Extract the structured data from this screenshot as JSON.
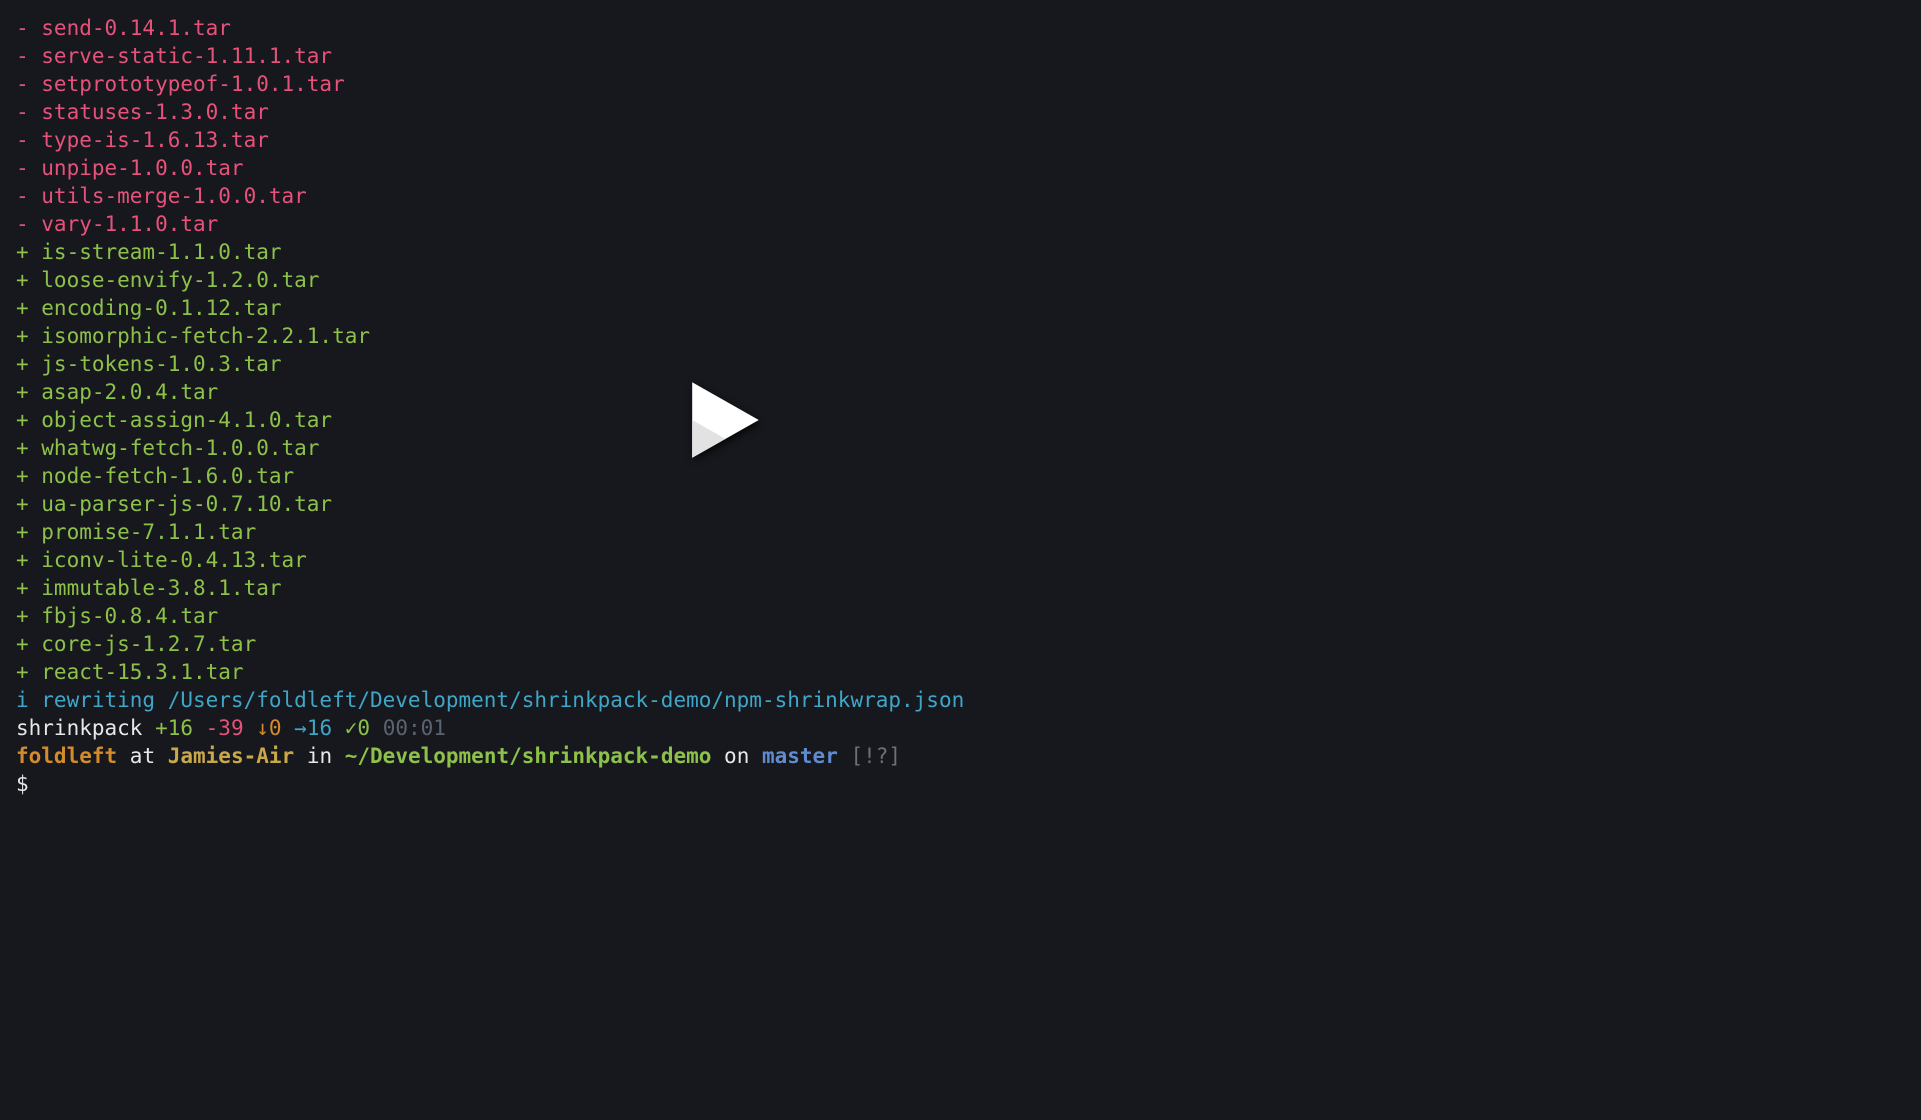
{
  "removed": [
    "send-0.14.1.tar",
    "serve-static-1.11.1.tar",
    "setprototypeof-1.0.1.tar",
    "statuses-1.3.0.tar",
    "type-is-1.6.13.tar",
    "unpipe-1.0.0.tar",
    "utils-merge-1.0.0.tar",
    "vary-1.1.0.tar"
  ],
  "added": [
    "is-stream-1.1.0.tar",
    "loose-envify-1.2.0.tar",
    "encoding-0.1.12.tar",
    "isomorphic-fetch-2.2.1.tar",
    "js-tokens-1.0.3.tar",
    "asap-2.0.4.tar",
    "object-assign-4.1.0.tar",
    "whatwg-fetch-1.0.0.tar",
    "node-fetch-1.6.0.tar",
    "ua-parser-js-0.7.10.tar",
    "promise-7.1.1.tar",
    "iconv-lite-0.4.13.tar",
    "immutable-3.8.1.tar",
    "fbjs-0.8.4.tar",
    "core-js-1.2.7.tar",
    "react-15.3.1.tar"
  ],
  "infoLine": {
    "label": "i",
    "text": "rewriting /Users/foldleft/Development/shrinkpack-demo/npm-shrinkwrap.json"
  },
  "summary": {
    "cmd": "shrinkpack",
    "plus": "+16",
    "minus": "-39",
    "down": "↓0",
    "arrow": "→16",
    "check": "✓0",
    "time": "00:01"
  },
  "prompt": {
    "user": "foldleft",
    "at": "at",
    "host": "Jamies-Air",
    "in": "in",
    "path": "~/Development/shrinkpack-demo",
    "on": "on",
    "branch": "master",
    "flags": "[!?]",
    "ps1": "$"
  }
}
